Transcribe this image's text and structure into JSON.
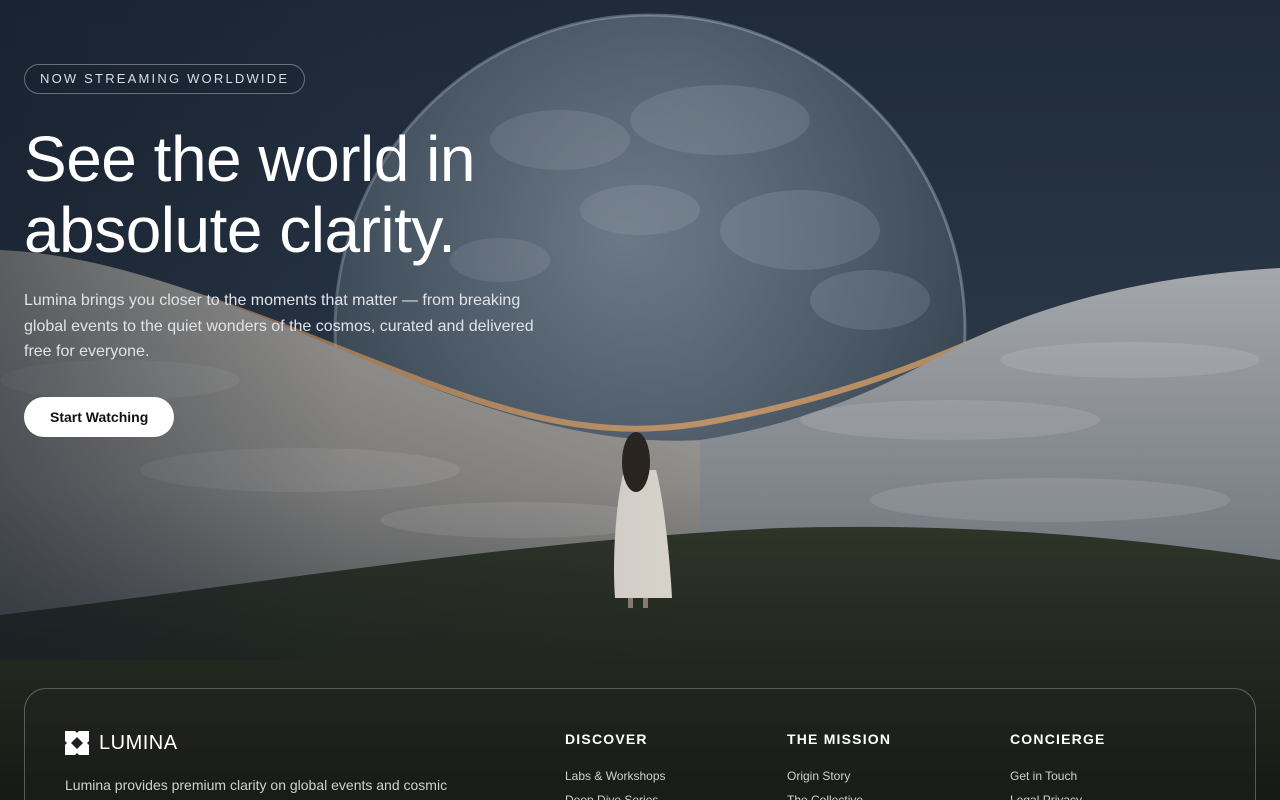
{
  "hero": {
    "badge": "NOW STREAMING WORLDWIDE",
    "headline_line1": "See the world in",
    "headline_line2": "absolute clarity.",
    "subtext": "Lumina brings you closer to the moments that matter — from breaking global events to the quiet wonders of the cosmos, curated and delivered free for everyone.",
    "cta_label": "Start Watching"
  },
  "footer": {
    "brand_name": "LUMINA",
    "brand_logo_icon": "diamond-quad-logo-icon",
    "description": "Lumina provides premium clarity on global events and cosmic",
    "columns": [
      {
        "title": "DISCOVER",
        "links": [
          "Labs & Workshops",
          "Deep Dive Series"
        ]
      },
      {
        "title": "THE MISSION",
        "links": [
          "Origin Story",
          "The Collective"
        ]
      },
      {
        "title": "CONCIERGE",
        "links": [
          "Get in Touch",
          "Legal Privacy"
        ]
      }
    ]
  },
  "colors": {
    "sky": "#1e2a3a",
    "planet": "#5d6b79",
    "clouds": "#a9a6a1",
    "glow": "#e8a766",
    "hill": "#23281f",
    "cta_bg": "#ffffff"
  }
}
